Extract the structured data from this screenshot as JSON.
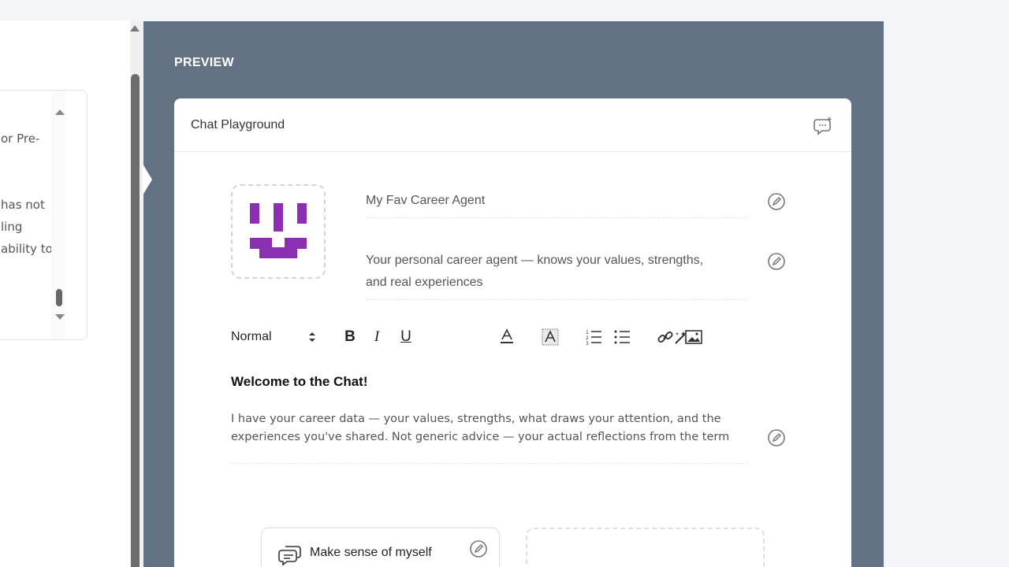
{
  "left_panel": {
    "lines": [
      "or Pre-",
      "has not",
      "ling",
      "ability to"
    ]
  },
  "preview": {
    "label": "PREVIEW",
    "chat": {
      "title": "Chat Playground",
      "agent_name": "My Fav Career Agent",
      "agent_description": "Your personal career agent — knows your values, strengths, and real experiences",
      "agent_description_lines": [
        "Your personal career agent — knows your values, strengths,",
        "and real experiences"
      ],
      "toolbar": {
        "format": "Normal",
        "bold": "B",
        "italic": "I",
        "underline": "U"
      },
      "welcome_title": "Welcome to the Chat!",
      "welcome_lines": [
        "I have your career data — your values, strengths, what draws your attention, and the",
        "experiences you've shared. Not generic advice — your actual reflections from the term"
      ],
      "suggestions": [
        {
          "label": "Make sense of myself"
        }
      ]
    }
  },
  "colors": {
    "preview_bg": "#627282",
    "avatar_purple": "#8b2fb3"
  }
}
